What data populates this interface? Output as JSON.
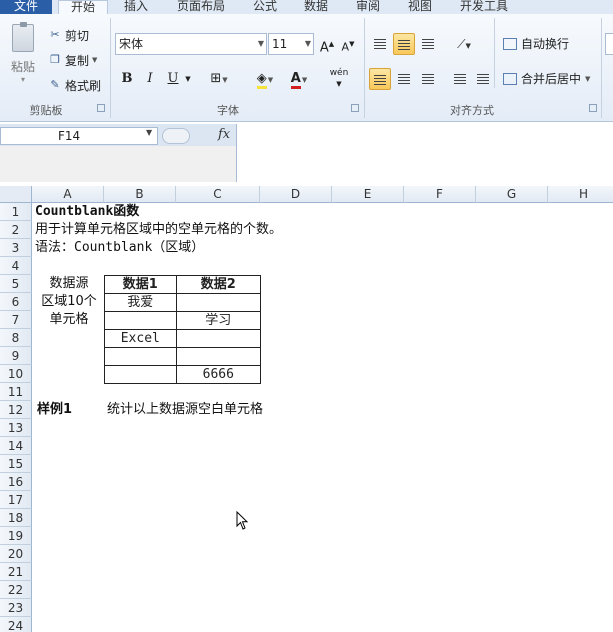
{
  "ribbon": {
    "tabs": [
      "文件",
      "开始",
      "插入",
      "页面布局",
      "公式",
      "数据",
      "审阅",
      "视图",
      "开发工具"
    ],
    "clipboard": {
      "paste_label": "粘贴",
      "cut_label": "剪切",
      "copy_label": "复制",
      "format_painter_label": "格式刷",
      "group_label": "剪贴板"
    },
    "font": {
      "font_name": "宋体",
      "font_size": "11",
      "group_label": "字体",
      "bold": "B",
      "italic": "I",
      "underline": "U",
      "phonetic": "wén"
    },
    "alignment": {
      "wrap_text_label": "自动换行",
      "merge_center_label": "合并后居中",
      "group_label": "对齐方式"
    }
  },
  "formula_bar": {
    "name_box": "F14",
    "fx": "fx",
    "formula": ""
  },
  "grid": {
    "columns": [
      "A",
      "B",
      "C",
      "D",
      "E",
      "F",
      "G",
      "H"
    ],
    "rows": [
      "1",
      "2",
      "3",
      "4",
      "5",
      "6",
      "7",
      "8",
      "9",
      "10",
      "11",
      "12",
      "13",
      "14",
      "15",
      "16",
      "17",
      "18",
      "19",
      "20",
      "21",
      "22",
      "23",
      "24"
    ],
    "title": "Countblank函数",
    "description": "用于计算单元格区域中的空单元格的个数。",
    "syntax": "语法：Countblank（区域）",
    "source_label": [
      "数据源",
      "区域10个",
      "单元格"
    ],
    "table": {
      "headers": [
        "数据1",
        "数据2"
      ],
      "rows": [
        [
          "我爱",
          ""
        ],
        [
          "",
          "学习"
        ],
        [
          "Excel",
          ""
        ],
        [
          "",
          ""
        ],
        [
          "",
          "6666"
        ]
      ]
    },
    "example_label": "样例1",
    "example_text": "统计以上数据源空白单元格"
  }
}
